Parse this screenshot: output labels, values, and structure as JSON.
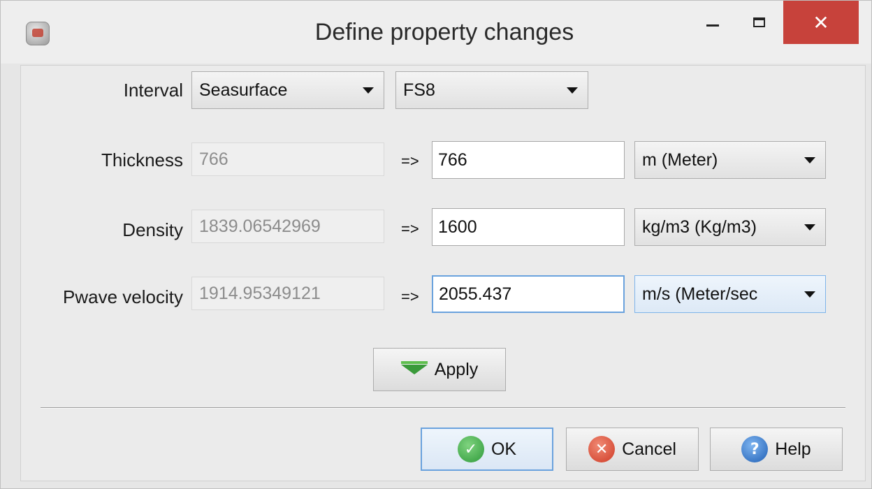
{
  "window": {
    "title": "Define property changes",
    "close_glyph": "✕",
    "app_icon": "app-icon"
  },
  "interval": {
    "label": "Interval",
    "from": "Seasurface",
    "to": "FS8"
  },
  "rows": [
    {
      "label": "Thickness",
      "old_value": "766",
      "arrow": "=>",
      "new_value": "766",
      "unit": "m (Meter)"
    },
    {
      "label": "Density",
      "old_value": "1839.06542969",
      "arrow": "=>",
      "new_value": "1600",
      "unit": "kg/m3 (Kg/m3)"
    },
    {
      "label": "Pwave velocity",
      "old_value": "1914.95349121",
      "arrow": "=>",
      "new_value": "2055.437",
      "unit": "m/s (Meter/sec"
    }
  ],
  "apply": {
    "label": "Apply",
    "icon": "down-triangle-icon"
  },
  "footer": {
    "ok_label": "OK",
    "cancel_label": "Cancel",
    "help_label": "Help",
    "ok_glyph": "✓",
    "cancel_glyph": "✕",
    "help_glyph": "?"
  },
  "colors": {
    "close_button": "#c7423b",
    "focus_border": "#6aa2dd",
    "apply_icon": "#3a9a3a"
  }
}
